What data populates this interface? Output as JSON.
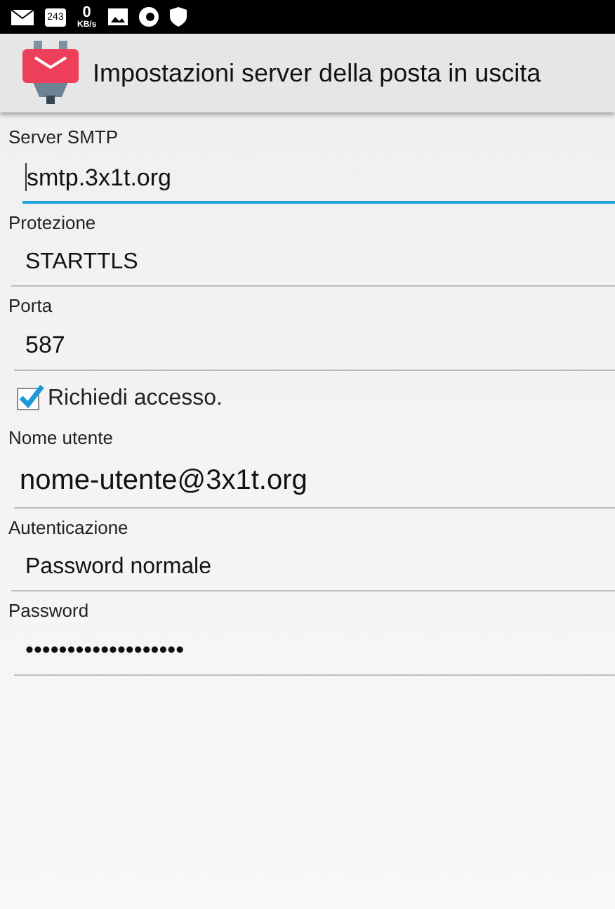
{
  "status_bar": {
    "calendar_day": "243",
    "speed_value": "0",
    "speed_unit": "KB/s"
  },
  "title": "Impostazioni server della posta in uscita",
  "fields": [
    {
      "kind": "text",
      "label": "Server SMTP",
      "value": "smtp.3x1t.org",
      "focused": true,
      "large": false
    },
    {
      "kind": "select",
      "label": "Protezione",
      "value": "STARTTLS"
    },
    {
      "kind": "text",
      "label": "Porta",
      "value": "587",
      "focused": false,
      "large": false
    },
    {
      "kind": "checkbox",
      "label": "Richiedi accesso.",
      "checked": true
    },
    {
      "kind": "text",
      "label": "Nome utente",
      "value": "nome-utente@3x1t.org",
      "focused": false,
      "large": true
    },
    {
      "kind": "select",
      "label": "Autenticazione",
      "value": "Password normale"
    },
    {
      "kind": "text",
      "label": "Password",
      "value": "•••••••••••••••••••",
      "focused": false,
      "large": false
    }
  ]
}
